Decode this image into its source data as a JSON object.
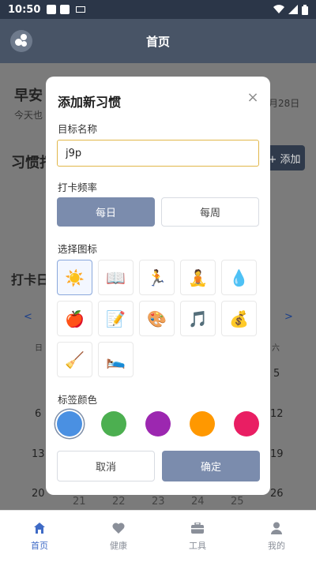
{
  "status_bar": {
    "time": "10:50"
  },
  "app_bar": {
    "title": "首页"
  },
  "background": {
    "greeting": "早安",
    "subtitle": "今天也",
    "date": "月28日",
    "habits_heading": "习惯打",
    "add_button": "+ 添加",
    "checkin_heading": "打卡日",
    "prev_arrow": "<",
    "next_arrow": ">",
    "weekday_left": "日",
    "weekday_right": "六",
    "cal_left": [
      "6",
      "13",
      "20"
    ],
    "cal_right": [
      "5",
      "12",
      "19",
      "26"
    ],
    "cal_bottom_row": [
      "21",
      "22",
      "23",
      "24",
      "25"
    ]
  },
  "modal": {
    "title": "添加新习惯",
    "close_label": "×",
    "name_label": "目标名称",
    "name_value": "j9p",
    "frequency_label": "打卡频率",
    "frequency_options": [
      "每日",
      "每周"
    ],
    "frequency_selected": "每日",
    "icon_label": "选择图标",
    "icons": [
      {
        "name": "sun-icon",
        "glyph": "☀️",
        "selected": true
      },
      {
        "name": "book-icon",
        "glyph": "📖"
      },
      {
        "name": "running-icon",
        "glyph": "🏃"
      },
      {
        "name": "meditation-icon",
        "glyph": "🧘"
      },
      {
        "name": "water-drop-icon",
        "glyph": "💧"
      },
      {
        "name": "apple-icon",
        "glyph": "🍎"
      },
      {
        "name": "memo-icon",
        "glyph": "📝"
      },
      {
        "name": "palette-icon",
        "glyph": "🎨"
      },
      {
        "name": "music-icon",
        "glyph": "🎵"
      },
      {
        "name": "money-bag-icon",
        "glyph": "💰"
      },
      {
        "name": "broom-icon",
        "glyph": "🧹"
      },
      {
        "name": "bed-icon",
        "glyph": "🛌"
      }
    ],
    "color_label": "标签颜色",
    "colors": [
      {
        "name": "blue",
        "hex": "#4a90e2",
        "selected": true
      },
      {
        "name": "green",
        "hex": "#4caf50"
      },
      {
        "name": "purple",
        "hex": "#9c27b0"
      },
      {
        "name": "orange",
        "hex": "#ff9800"
      },
      {
        "name": "pink",
        "hex": "#e91e63"
      }
    ],
    "cancel_label": "取消",
    "confirm_label": "确定"
  },
  "bottom_nav": {
    "items": [
      {
        "label": "首页",
        "icon": "home-icon",
        "active": true
      },
      {
        "label": "健康",
        "icon": "heart-icon"
      },
      {
        "label": "工具",
        "icon": "toolbox-icon"
      },
      {
        "label": "我的",
        "icon": "person-icon"
      }
    ]
  },
  "colors": {
    "accent": "#7b8cad",
    "app_bar": "#485466",
    "nav_active": "#3f6bc6"
  }
}
